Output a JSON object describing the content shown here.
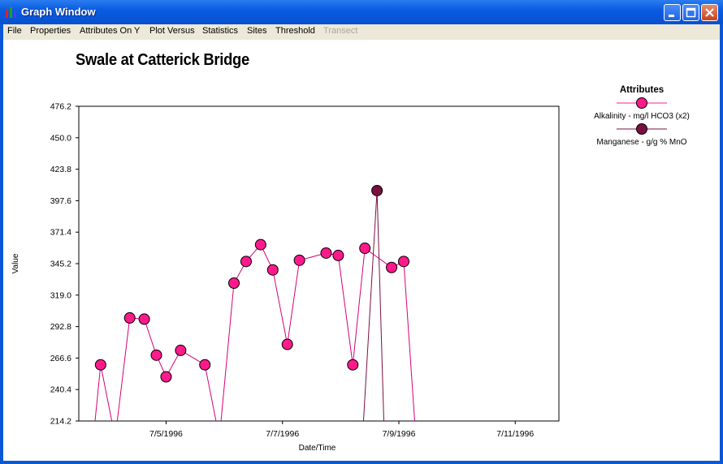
{
  "window": {
    "title": "Graph Window",
    "colors": {
      "titlebar": "#0a5ce0",
      "alkalinity": "#ff1a8c",
      "manganese": "#7a1040",
      "line": "#d6007a"
    }
  },
  "menu": {
    "items": [
      "File",
      "Properties",
      "Attributes On Y",
      "Plot Versus",
      "Statistics",
      "Sites",
      "Threshold"
    ],
    "disabled_item": "Transect"
  },
  "graph": {
    "title": "Swale at Catterick Bridge",
    "legend": {
      "title": "Attributes",
      "entries": [
        {
          "label": "Alkalinity - mg/l HCO3 (x2)",
          "color": "#ff1a8c"
        },
        {
          "label": "Manganese - g/g % MnO",
          "color": "#7a1040"
        }
      ]
    }
  },
  "chart_data": {
    "type": "line",
    "xlabel": "Date/Time",
    "ylabel": "Value",
    "ylim": [
      214.2,
      476.2
    ],
    "yticks": [
      "476.2",
      "450.0",
      "423.8",
      "397.6",
      "371.4",
      "345.2",
      "319.0",
      "292.8",
      "266.6",
      "240.4",
      "214.2"
    ],
    "xlim": [
      "7/3/1996 12:00",
      "7/11/1996 18:00"
    ],
    "xticks": [
      "7/5/1996",
      "7/7/1996",
      "7/9/1996",
      "7/11/1996"
    ],
    "series": [
      {
        "name": "Alkalinity - mg/l HCO3 (x2)",
        "color": "#ff1a8c",
        "points": [
          {
            "x": "7/3/1996 18:00",
            "y": 200
          },
          {
            "x": "7/3/1996 21:00",
            "y": 261
          },
          {
            "x": "7/4/1996 03:00",
            "y": 200
          },
          {
            "x": "7/4/1996 09:00",
            "y": 300
          },
          {
            "x": "7/4/1996 15:00",
            "y": 299
          },
          {
            "x": "7/4/1996 20:00",
            "y": 269
          },
          {
            "x": "7/5/1996 00:00",
            "y": 251
          },
          {
            "x": "7/5/1996 06:00",
            "y": 273
          },
          {
            "x": "7/5/1996 16:00",
            "y": 261
          },
          {
            "x": "7/5/1996 22:00",
            "y": 200
          },
          {
            "x": "7/6/1996 04:00",
            "y": 329
          },
          {
            "x": "7/6/1996 09:00",
            "y": 347
          },
          {
            "x": "7/6/1996 15:00",
            "y": 361
          },
          {
            "x": "7/6/1996 20:00",
            "y": 340
          },
          {
            "x": "7/7/1996 02:00",
            "y": 278
          },
          {
            "x": "7/7/1996 07:00",
            "y": 348
          },
          {
            "x": "7/7/1996 18:00",
            "y": 354
          },
          {
            "x": "7/7/1996 23:00",
            "y": 352
          },
          {
            "x": "7/8/1996 05:00",
            "y": 261
          },
          {
            "x": "7/8/1996 10:00",
            "y": 358
          },
          {
            "x": "7/8/1996 21:00",
            "y": 342
          },
          {
            "x": "7/9/1996 02:00",
            "y": 347
          },
          {
            "x": "7/9/1996 07:00",
            "y": 200
          }
        ]
      },
      {
        "name": "Manganese - g/g % MnO",
        "color": "#7a1040",
        "points": [
          {
            "x": "7/8/1996 09:00",
            "y": 200
          },
          {
            "x": "7/8/1996 15:00",
            "y": 406
          },
          {
            "x": "7/8/1996 18:00",
            "y": 200
          }
        ]
      }
    ]
  }
}
